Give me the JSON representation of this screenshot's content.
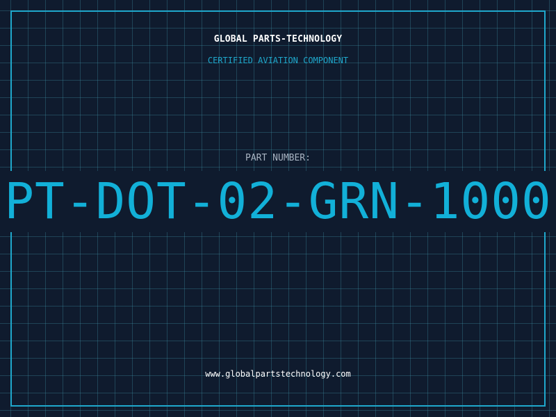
{
  "header": {
    "company": "GLOBAL PARTS-TECHNOLOGY",
    "tagline": "CERTIFIED AVIATION COMPONENT"
  },
  "part": {
    "label": "PART NUMBER:",
    "number": "PT-DOT-02-GRN-1000"
  },
  "footer": {
    "website": "www.globalpartstechnology.com"
  },
  "colors": {
    "background": "#0f1b2e",
    "accent": "#1fa8cc",
    "grid": "#2a5a70",
    "text": "#ffffff"
  }
}
